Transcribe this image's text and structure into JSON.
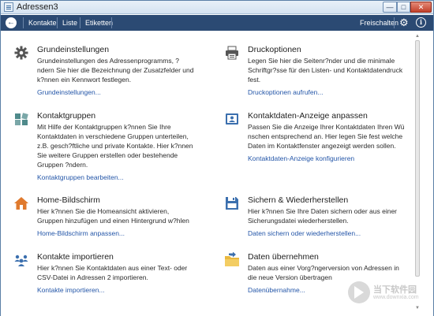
{
  "window": {
    "title": "Adressen3",
    "buttons": {
      "minimize": "—",
      "maximize": "□",
      "close": "✕"
    }
  },
  "toolbar": {
    "back_icon": "←",
    "items": [
      "Kontakte",
      "Liste",
      "Etiketten"
    ],
    "right_item": "Freischalten",
    "gear_icon": "⚙",
    "info_icon": "i"
  },
  "cards": [
    {
      "title": "Grundeinstellungen",
      "desc": "Grundeinstellungen des Adressenprogramms, ?ndern Sie hier die Bezeichnung der Zusatzfelder und k?nnen ein Kennwort festlegen.",
      "link": "Grundeinstellungen...",
      "icon": "gear-icon"
    },
    {
      "title": "Druckoptionen",
      "desc": "Legen Sie hier die Seitenr?nder und die minimale Schriftgr?sse für den Listen- und Kontaktdatendruck fest.",
      "link": "Druckoptionen aufrufen...",
      "icon": "printer-icon"
    },
    {
      "title": "Kontaktgruppen",
      "desc": "Mit Hilfe der Kontaktgruppen k?nnen Sie Ihre Kontaktdaten in verschiedene Gruppen unterteilen, z.B. gesch?ftliche und private Kontakte. Hier k?nnen Sie weitere Gruppen erstellen oder bestehende Gruppen ?ndern.",
      "link": "Kontaktgruppen bearbeiten...",
      "icon": "groups-icon"
    },
    {
      "title": "Kontaktdaten-Anzeige anpassen",
      "desc": "Passen Sie die Anzeige Ihrer Kontaktdaten Ihren Wü nschen entsprechend an. Hier legen Sie fest welche Daten im Kontaktfenster angezeigt werden sollen.",
      "link": "Kontaktdaten-Anzeige konfigurieren",
      "icon": "contact-card-icon"
    },
    {
      "title": "Home-Bildschirm",
      "desc": "Hier k?nnen Sie die Homeansicht aktivieren, Gruppen hinzufügen und einen Hintergrund w?hlen",
      "link": "Home-Bildschirm anpassen...",
      "icon": "home-icon"
    },
    {
      "title": "Sichern & Wiederherstellen",
      "desc": "Hier k?nnen Sie Ihre Daten sichern oder aus einer Sicherungsdatei wiederherstellen.",
      "link": "Daten sichern oder wiederherstellen...",
      "icon": "save-disk-icon"
    },
    {
      "title": "Kontakte importieren",
      "desc": "Hier k?nnen Sie Kontaktdaten aus einer Text- oder CSV-Datei in Adressen 2 importieren.",
      "link": "Kontakte importieren...",
      "icon": "import-people-icon"
    },
    {
      "title": "Daten übernehmen",
      "desc": "Daten aus einer Vorg?ngerversion von Adressen in die neue Version übertragen",
      "link": "Datenübernahme...",
      "icon": "folder-transfer-icon"
    }
  ],
  "watermark": {
    "line1": "当下软件园",
    "line2": "www.downxia.com"
  },
  "colors": {
    "toolbar": "#2b4a73",
    "link": "#2456a8",
    "icon_blue": "#3b6fae"
  }
}
